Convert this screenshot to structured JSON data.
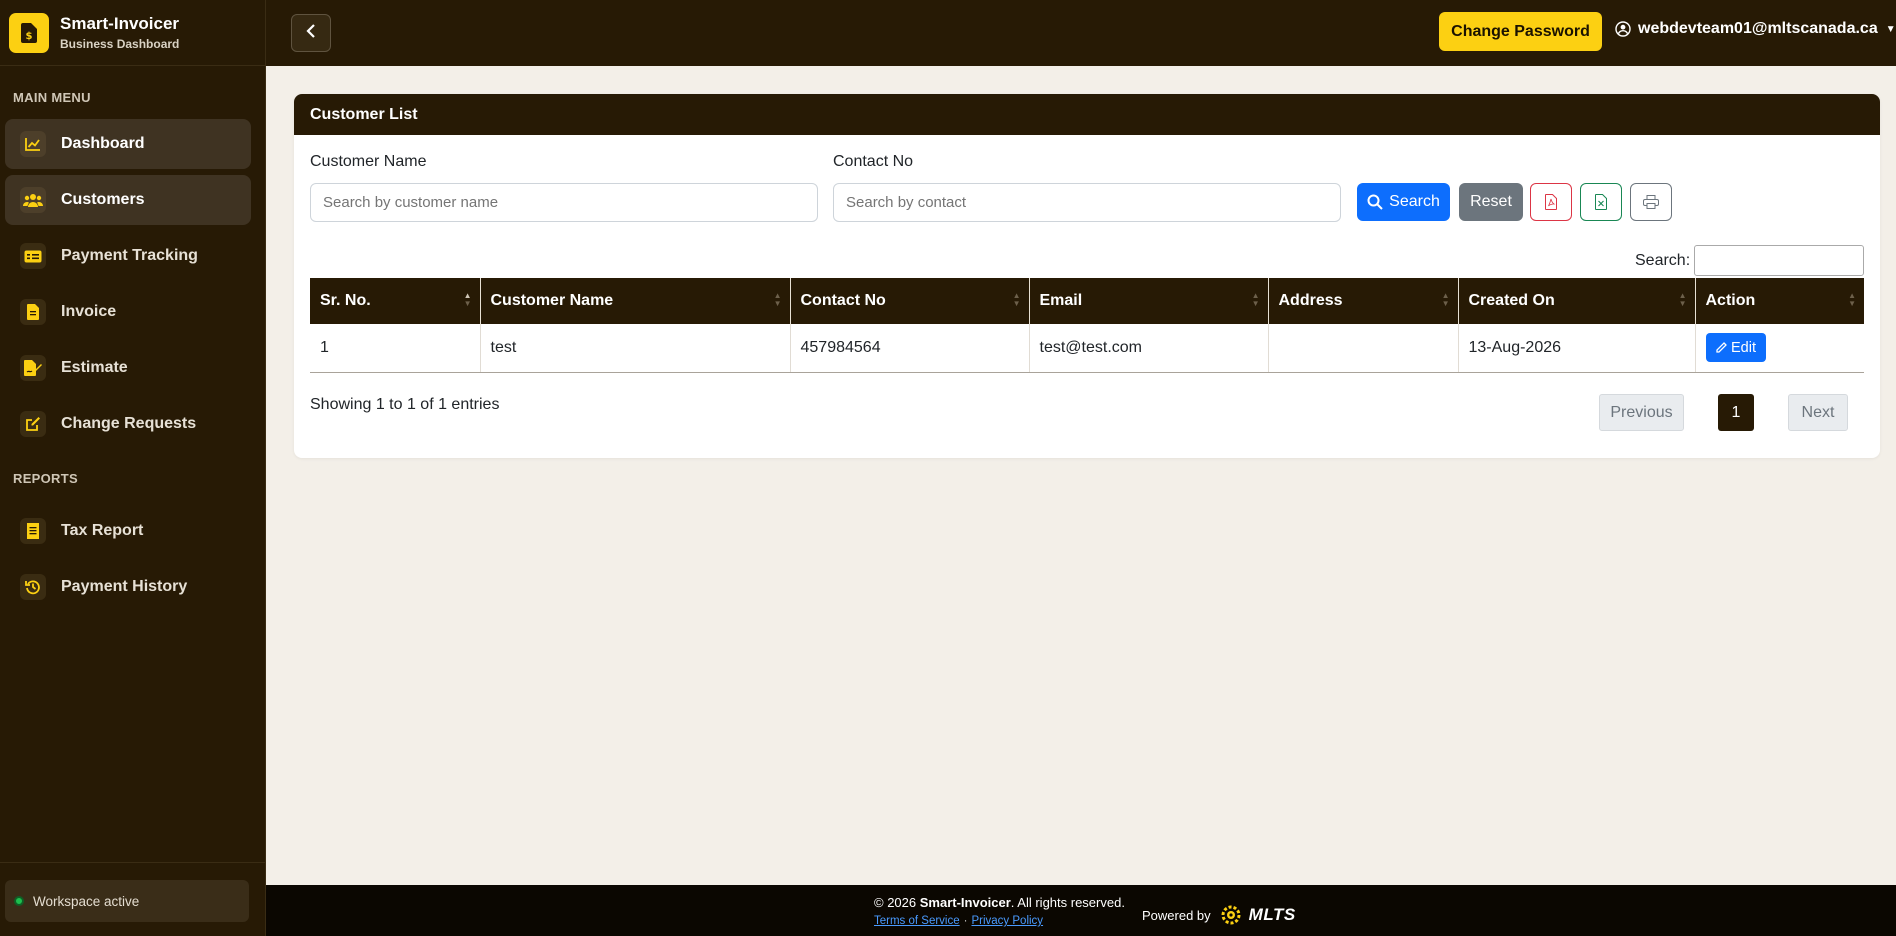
{
  "brand": {
    "name": "Smart-Invoicer",
    "subtitle": "Business Dashboard"
  },
  "sidebar": {
    "main_menu_label": "MAIN MENU",
    "reports_label": "REPORTS",
    "items": [
      {
        "label": "Dashboard",
        "icon": "chart-line-icon"
      },
      {
        "label": "Customers",
        "icon": "users-icon"
      },
      {
        "label": "Payment Tracking",
        "icon": "card-icon"
      },
      {
        "label": "Invoice",
        "icon": "file-icon"
      },
      {
        "label": "Estimate",
        "icon": "file-signature-icon"
      },
      {
        "label": "Change Requests",
        "icon": "edit-icon"
      }
    ],
    "report_items": [
      {
        "label": "Tax Report",
        "icon": "receipt-icon"
      },
      {
        "label": "Payment History",
        "icon": "history-icon"
      }
    ],
    "workspace_status": "Workspace active"
  },
  "topbar": {
    "change_password_label": "Change Password",
    "user_email": "webdevteam01@mltscanada.ca"
  },
  "card": {
    "title": "Customer List",
    "customer_name_label": "Customer Name",
    "customer_name_placeholder": "Search by customer name",
    "contact_label": "Contact No",
    "contact_placeholder": "Search by contact",
    "search_label": "Search",
    "reset_label": "Reset",
    "table_search_label": "Search:"
  },
  "table": {
    "columns": [
      "Sr. No.",
      "Customer Name",
      "Contact No",
      "Email",
      "Address",
      "Created On",
      "Action"
    ],
    "rows": [
      {
        "sr": "1",
        "name": "test",
        "contact": "457984564",
        "email": "test@test.com",
        "address": "",
        "created": "13-Aug-2026",
        "action": "Edit"
      }
    ],
    "info": "Showing 1 to 1 of 1 entries",
    "prev": "Previous",
    "page": "1",
    "next": "Next"
  },
  "footer": {
    "copyright_prefix": "© 2026 ",
    "copyright_brand": "Smart-Invoicer",
    "copyright_suffix": ". All rights reserved.",
    "terms": "Terms of Service",
    "separator": "·",
    "privacy": "Privacy Policy",
    "powered_by": "Powered by",
    "powered_logo": "MLTS"
  },
  "colors": {
    "brand_dark": "#271a05",
    "accent": "#fcd012",
    "primary": "#0d6efd"
  }
}
